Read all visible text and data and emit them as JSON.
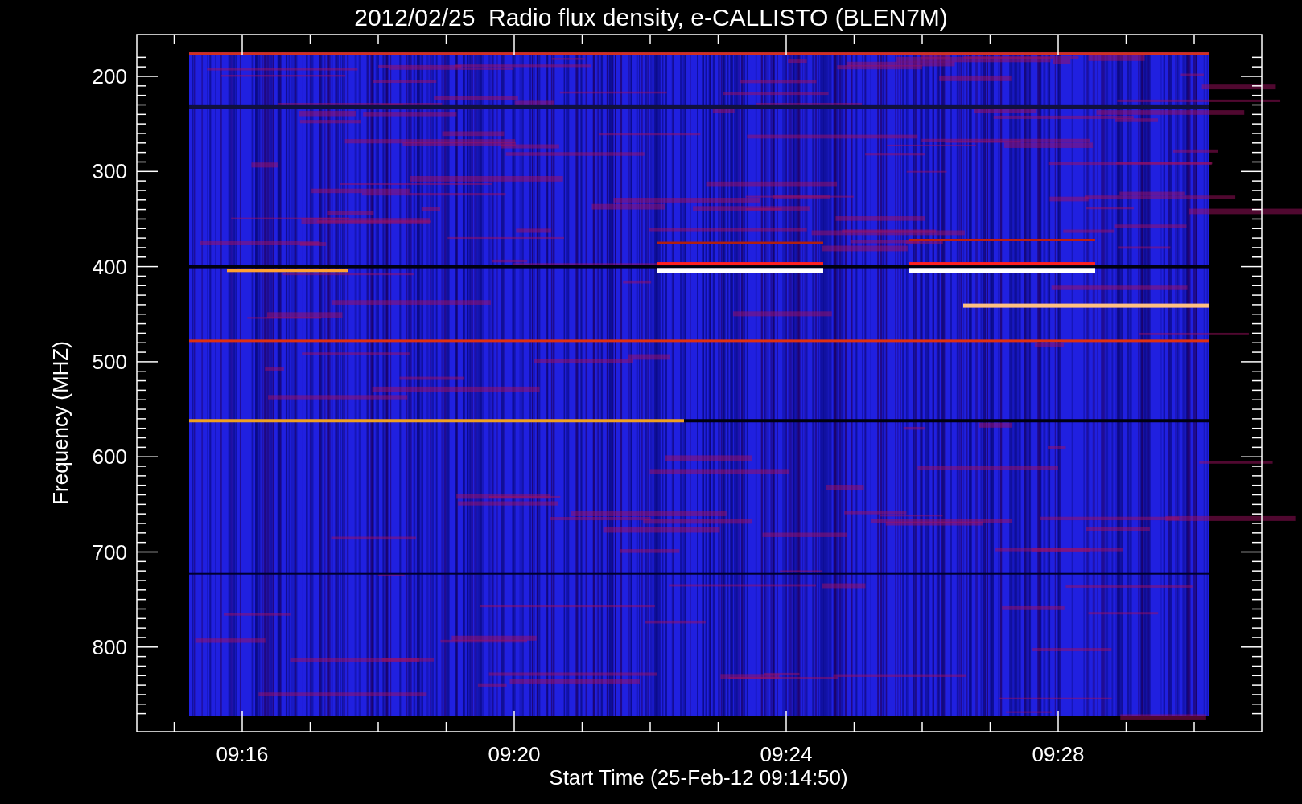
{
  "title": "2012/02/25  Radio flux density, e-CALLISTO (BLEN7M)",
  "y_axis": {
    "label": "Frequency (MHZ)",
    "ticks": [
      "200",
      "300",
      "400",
      "500",
      "600",
      "700",
      "800"
    ]
  },
  "x_axis": {
    "label": "Start Time (25-Feb-12 09:14:50)",
    "ticks": [
      "09:16",
      "09:20",
      "09:24",
      "09:28"
    ]
  }
}
